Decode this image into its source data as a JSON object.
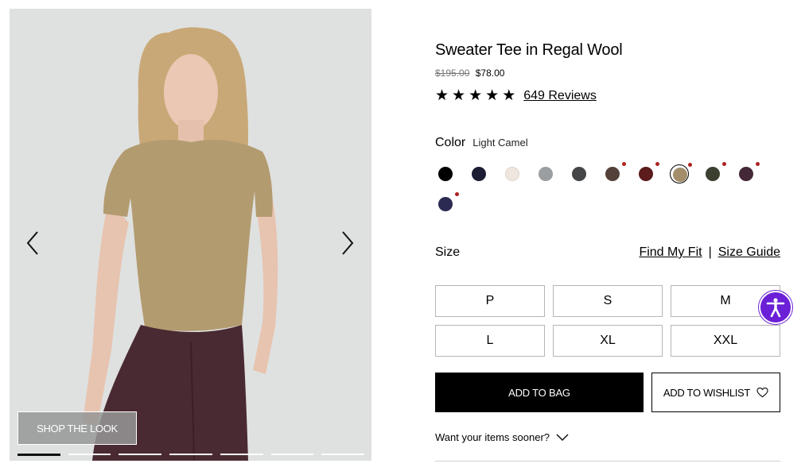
{
  "gallery": {
    "shop_the_look_label": "SHOP THE LOOK",
    "prev_icon": "chevron-left-icon",
    "next_icon": "chevron-right-icon",
    "slides_count": 7,
    "active_slide": 1
  },
  "product": {
    "title": "Sweater Tee in Regal Wool",
    "original_price": "$195.00",
    "sale_price": "$78.00",
    "rating": 5,
    "star_glyph": "★",
    "reviews_label": "649 Reviews"
  },
  "color": {
    "label": "Color",
    "selected_name": "Light Camel",
    "swatches": [
      {
        "hex": "#000000",
        "marked": false,
        "selected": false
      },
      {
        "hex": "#1c1d33",
        "marked": false,
        "selected": false
      },
      {
        "hex": "#efe7df",
        "marked": false,
        "selected": false
      },
      {
        "hex": "#9a9ea0",
        "marked": false,
        "selected": false
      },
      {
        "hex": "#444648",
        "marked": false,
        "selected": false
      },
      {
        "hex": "#54413a",
        "marked": true,
        "selected": false
      },
      {
        "hex": "#5c1c1c",
        "marked": true,
        "selected": false
      },
      {
        "hex": "#a48e6a",
        "marked": true,
        "selected": true
      },
      {
        "hex": "#3b4030",
        "marked": true,
        "selected": false
      },
      {
        "hex": "#452838",
        "marked": true,
        "selected": false
      },
      {
        "hex": "#2a2a52",
        "marked": true,
        "selected": false
      }
    ]
  },
  "size": {
    "label": "Size",
    "find_fit_label": "Find My Fit",
    "separator": "|",
    "guide_label": "Size Guide",
    "options": [
      "P",
      "S",
      "M",
      "L",
      "XL",
      "XXL"
    ]
  },
  "actions": {
    "add_to_bag_label": "ADD TO BAG",
    "add_to_wishlist_label": "ADD TO WISHLIST",
    "wishlist_icon": "heart-icon"
  },
  "delivery": {
    "sooner_label": "Want your items sooner?",
    "sooner_icon": "chevron-down-icon"
  },
  "accessibility": {
    "icon": "accessibility-icon",
    "color": "#6b1fd6"
  }
}
